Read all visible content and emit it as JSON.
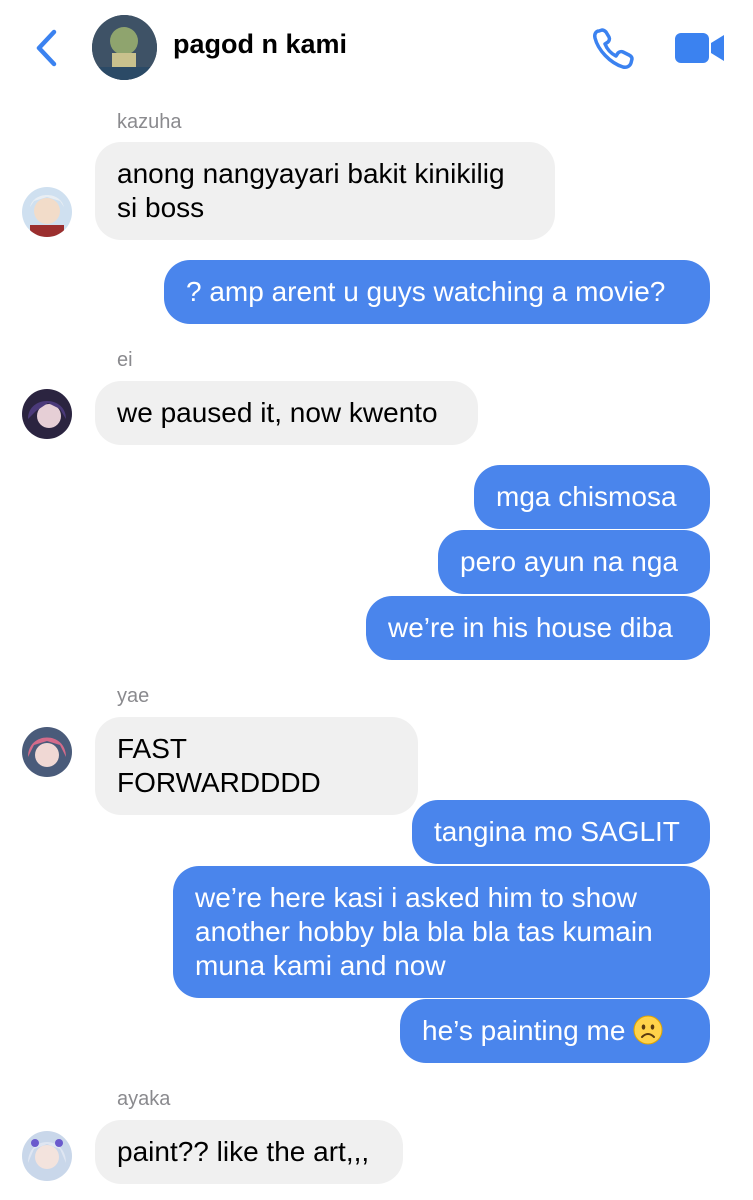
{
  "header": {
    "title": "pagod n kami",
    "back_icon": "chevron-left-icon",
    "call_icon": "phone-icon",
    "video_icon": "video-camera-icon",
    "accent_color": "#3b82f0"
  },
  "messages": [
    {
      "sender": "kazuha",
      "direction": "incoming",
      "lines": [
        "anong nangyayari bakit kinikilig",
        "si boss"
      ]
    },
    {
      "direction": "outgoing",
      "text": "? amp arent u guys watching a movie?"
    },
    {
      "sender": "ei",
      "direction": "incoming",
      "text": "we paused it, now kwento"
    },
    {
      "direction": "outgoing",
      "text": "mga chismosa"
    },
    {
      "direction": "outgoing",
      "text": "pero ayun na nga"
    },
    {
      "direction": "outgoing",
      "text": "we’re in his house diba"
    },
    {
      "sender": "yae",
      "direction": "incoming",
      "text": "FAST FORWARDDDD"
    },
    {
      "direction": "outgoing",
      "text": "tangina mo SAGLIT"
    },
    {
      "direction": "outgoing",
      "lines": [
        "we’re here kasi i asked him to show",
        "another hobby bla bla bla tas kumain",
        "muna kami and now"
      ]
    },
    {
      "direction": "outgoing",
      "text": "he’s painting me",
      "emoji": "frowning-face-emoji"
    },
    {
      "sender": "ayaka",
      "direction": "incoming",
      "text": "paint?? like the art,,,"
    }
  ],
  "colors": {
    "outgoing_bubble": "#4a85ec",
    "incoming_bubble": "#f0f0f0",
    "sender_label": "#8a8a8e"
  }
}
